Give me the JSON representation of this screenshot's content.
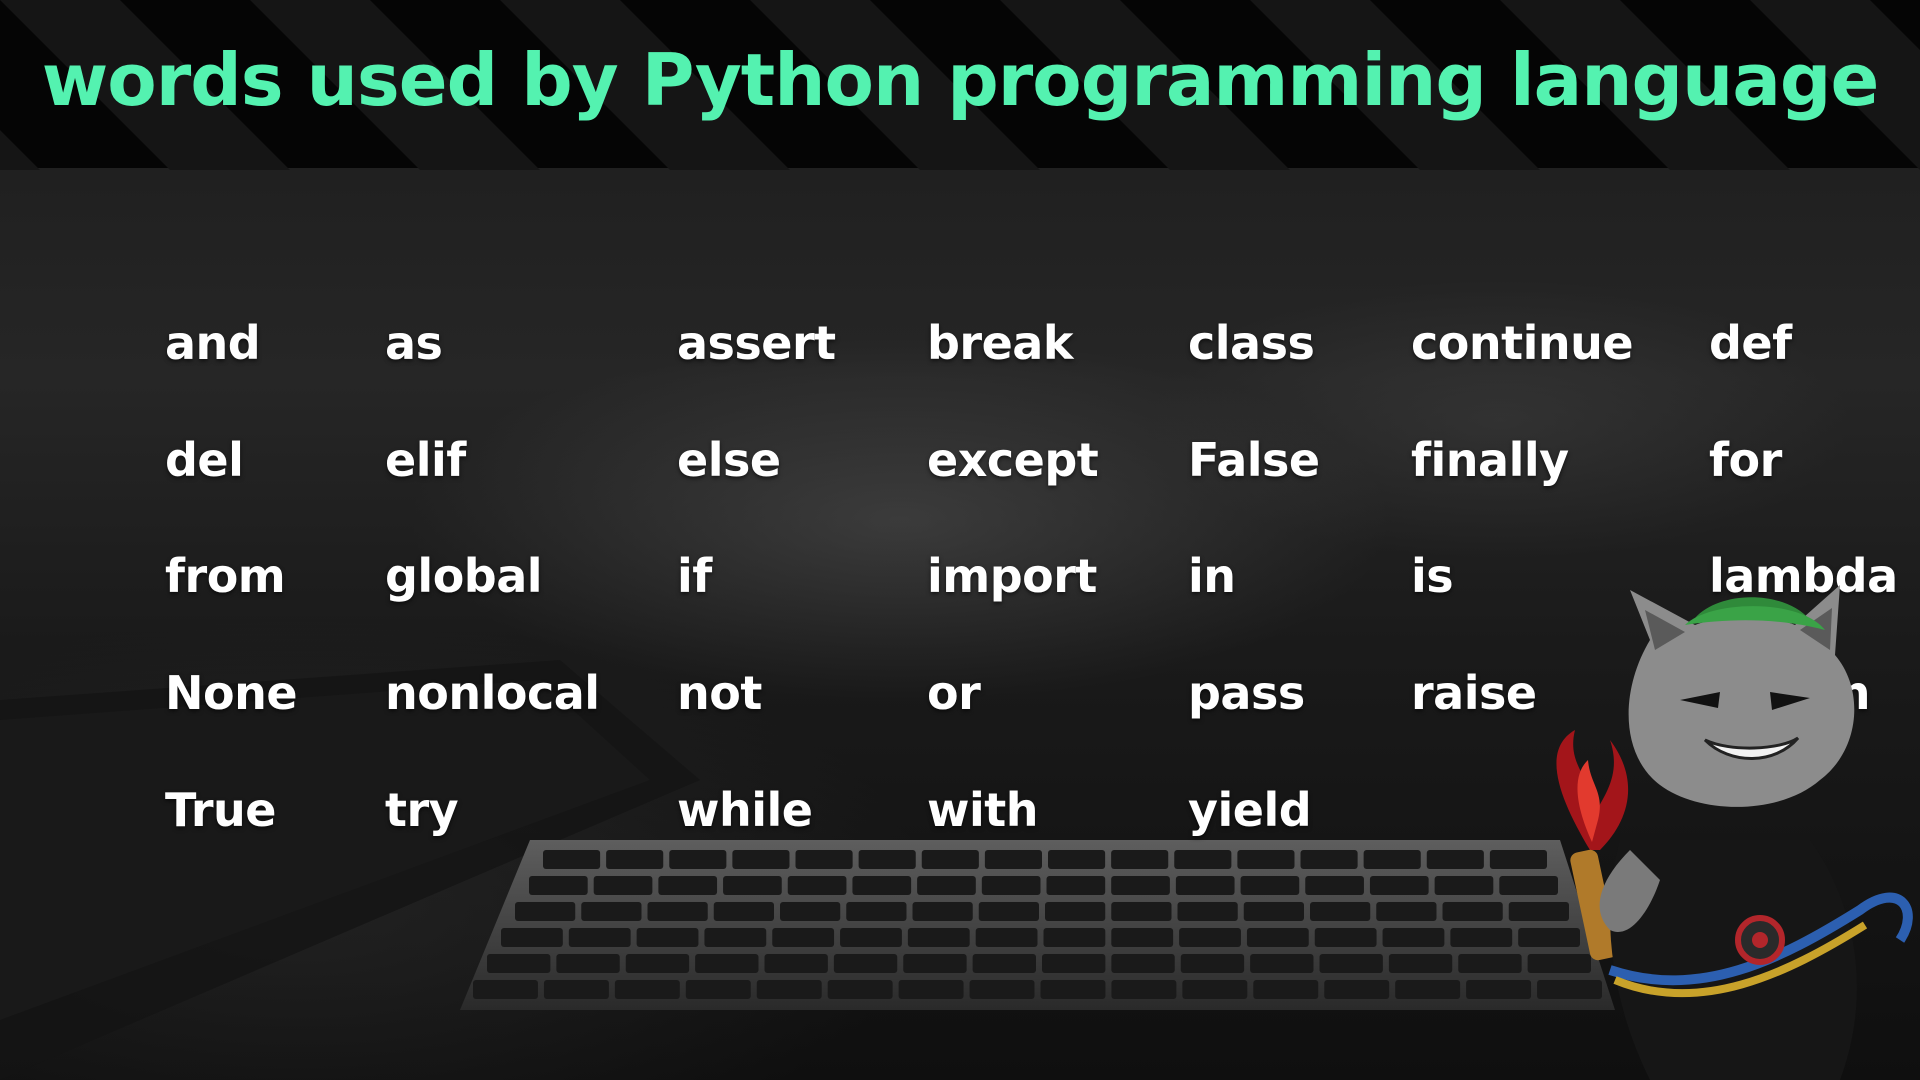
{
  "title": "words used by Python programming language",
  "colors": {
    "title": "#54f2b0",
    "keyword": "#ffffff",
    "background": "#0c0c0c"
  },
  "keywords": [
    [
      "and",
      "as",
      "assert",
      "break",
      "class",
      "continue",
      "def"
    ],
    [
      "del",
      "elif",
      "else",
      "except",
      "False",
      "finally",
      "for"
    ],
    [
      "from",
      "global",
      "if",
      "import",
      "in",
      "is",
      "lambda"
    ],
    [
      "None",
      "nonlocal",
      "not",
      "or",
      "pass",
      "raise",
      "return"
    ],
    [
      "True",
      "try",
      "while",
      "with",
      "yield"
    ]
  ],
  "images": {
    "background": "blurred-keyboard-photo",
    "mascot": "cat-mascot-with-welding-torch"
  }
}
